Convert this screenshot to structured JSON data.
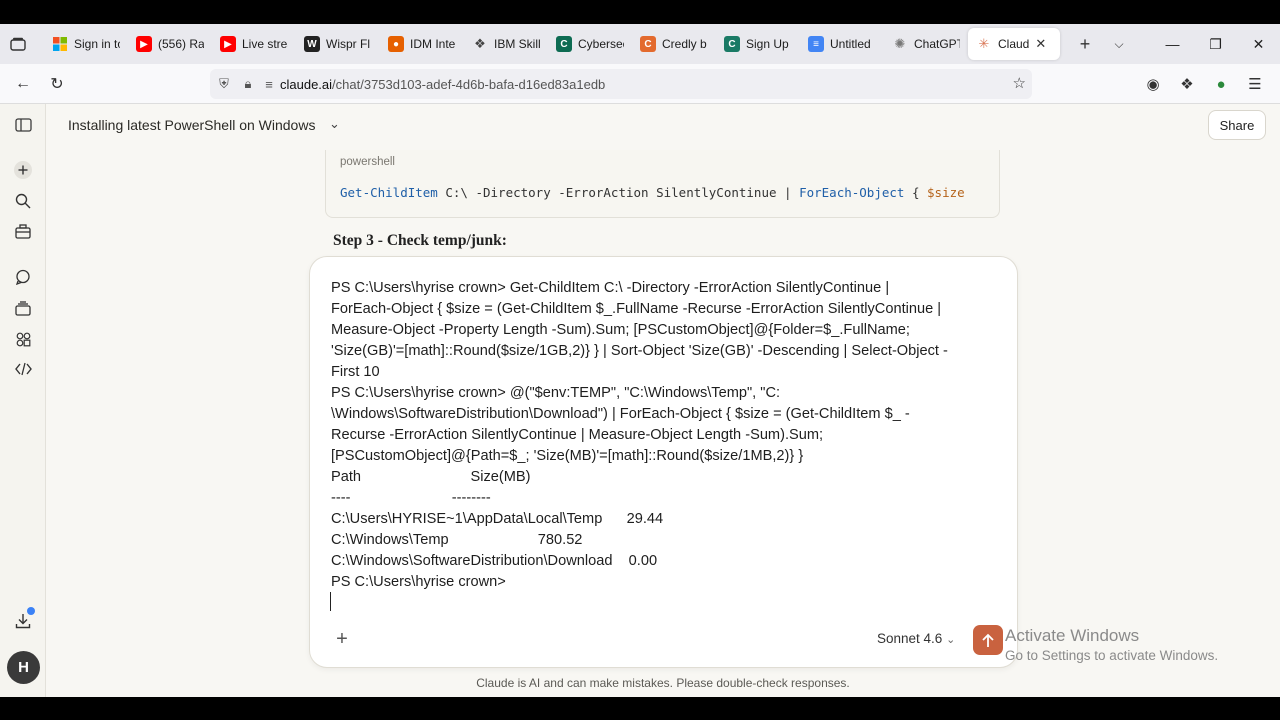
{
  "tabs": [
    {
      "label": "Sign in to",
      "icon": "microsoft-icon",
      "color": "#f25022"
    },
    {
      "label": "(556) Ra",
      "icon": "youtube-icon",
      "color": "#ff0000"
    },
    {
      "label": "Live strea",
      "icon": "youtube-icon",
      "color": "#ff0000"
    },
    {
      "label": "Wispr Fl",
      "icon": "wispr-icon",
      "color": "#222222"
    },
    {
      "label": "IDM Inte",
      "icon": "firefox-icon",
      "color": "#e66000"
    },
    {
      "label": "IBM Skill",
      "icon": "ibm-icon",
      "color": "#444444"
    },
    {
      "label": "Cybersec",
      "icon": "cybersec-icon",
      "color": "#0d6b52"
    },
    {
      "label": "Credly b",
      "icon": "credly-icon",
      "color": "#e36a2e"
    },
    {
      "label": "Sign Up",
      "icon": "coursera-icon",
      "color": "#1a7a65"
    },
    {
      "label": "Untitled",
      "icon": "docs-icon",
      "color": "#4285f4"
    },
    {
      "label": "ChatGPT",
      "icon": "chatgpt-icon",
      "color": "#777777"
    },
    {
      "label": "Claud",
      "icon": "claude-icon",
      "color": "#d97757"
    }
  ],
  "url": {
    "host": "claude.ai",
    "path": "/chat/3753d103-adef-4d6b-bafa-d16ed83a1edb"
  },
  "header": {
    "title": "Installing latest PowerShell on Windows",
    "share_label": "Share"
  },
  "code": {
    "language": "powershell",
    "cmd1": "Get-ChildItem",
    "args1": " C:\\ -Directory -ErrorAction SilentlyContinue | ",
    "cmd2": "ForEach-Object",
    "args2": " { ",
    "var1": "$size"
  },
  "step_heading": "Step 3 - Check temp/junk:",
  "composer": {
    "text": "PS C:\\Users\\hyrise crown> Get-ChildItem C:\\ -Directory -ErrorAction SilentlyContinue |\nForEach-Object { $size = (Get-ChildItem $_.FullName -Recurse -ErrorAction SilentlyContinue |\nMeasure-Object -Property Length -Sum).Sum; [PSCustomObject]@{Folder=$_.FullName;\n'Size(GB)'=[math]::Round($size/1GB,2)} } | Sort-Object 'Size(GB)' -Descending | Select-Object -\nFirst 10\nPS C:\\Users\\hyrise crown> @(\"$env:TEMP\", \"C:\\Windows\\Temp\", \"C:\n\\Windows\\SoftwareDistribution\\Download\") | ForEach-Object { $size = (Get-ChildItem $_ -\nRecurse -ErrorAction SilentlyContinue | Measure-Object Length -Sum).Sum;\n[PSCustomObject]@{Path=$_; 'Size(MB)'=[math]::Round($size/1MB,2)} }\nPath                           Size(MB)\n----                         --------\nC:\\Users\\HYRISE~1\\AppData\\Local\\Temp      29.44\nC:\\Windows\\Temp                      780.52\nC:\\Windows\\SoftwareDistribution\\Download    0.00\nPS C:\\Users\\hyrise crown>",
    "model": "Sonnet 4.6"
  },
  "watermark": {
    "line1": "Activate Windows",
    "line2": "Go to Settings to activate Windows."
  },
  "disclaimer": "Claude is AI and can make mistakes. Please double-check responses.",
  "avatar_initial": "H",
  "colors": {
    "accent": "#c9623f",
    "background": "#f8f7f3"
  }
}
